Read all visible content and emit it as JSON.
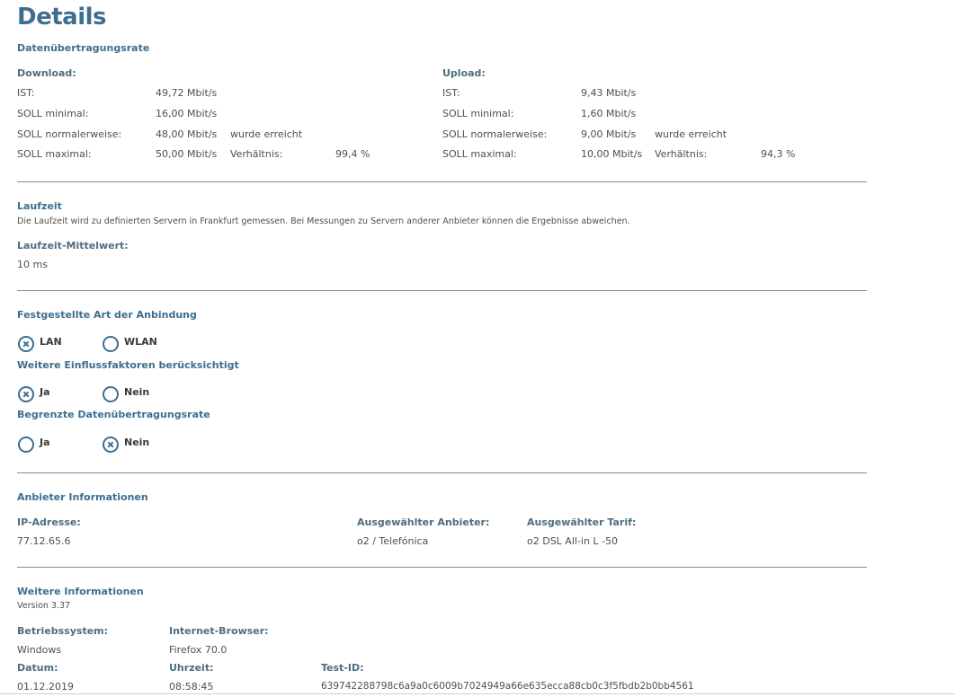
{
  "page": {
    "title": "Details"
  },
  "rate": {
    "section_title": "Datenübertragungsrate",
    "download": {
      "heading": "Download:",
      "ist_label": "IST:",
      "ist_value": "49,72 Mbit/s",
      "min_label": "SOLL minimal:",
      "min_value": "16,00 Mbit/s",
      "normal_label": "SOLL normalerweise:",
      "normal_value": "48,00 Mbit/s",
      "normal_status": "wurde erreicht",
      "max_label": "SOLL maximal:",
      "max_value": "50,00 Mbit/s",
      "ratio_label": "Verhältnis:",
      "ratio_value": "99,4 %"
    },
    "upload": {
      "heading": "Upload:",
      "ist_label": "IST:",
      "ist_value": "9,43 Mbit/s",
      "min_label": "SOLL minimal:",
      "min_value": "1,60 Mbit/s",
      "normal_label": "SOLL normalerweise:",
      "normal_value": "9,00 Mbit/s",
      "normal_status": "wurde erreicht",
      "max_label": "SOLL maximal:",
      "max_value": "10,00 Mbit/s",
      "ratio_label": "Verhältnis:",
      "ratio_value": "94,3 %"
    }
  },
  "latency": {
    "section_title": "Laufzeit",
    "note": "Die Laufzeit wird zu definierten Servern in Frankfurt gemessen. Bei Messungen zu Servern anderer Anbieter können die Ergebnisse abweichen.",
    "mean_label": "Laufzeit-Mittelwert:",
    "mean_value": "10 ms"
  },
  "connection": {
    "section_title": "Festgestellte Art der Anbindung",
    "type_options": [
      {
        "label": "LAN",
        "checked": true
      },
      {
        "label": "WLAN",
        "checked": false
      }
    ],
    "factors_title": "Weitere Einflussfaktoren berücksichtigt",
    "factors_options": [
      {
        "label": "Ja",
        "checked": true
      },
      {
        "label": "Nein",
        "checked": false
      }
    ],
    "limited_title": "Begrenzte Datenübertragungsrate",
    "limited_options": [
      {
        "label": "Ja",
        "checked": false
      },
      {
        "label": "Nein",
        "checked": true
      }
    ]
  },
  "provider": {
    "section_title": "Anbieter Informationen",
    "ip_label": "IP-Adresse:",
    "ip_value": "77.12.65.6",
    "provider_label": "Ausgewählter Anbieter:",
    "provider_value": "o2 / Telefónica",
    "tariff_label": "Ausgewählter Tarif:",
    "tariff_value": "o2 DSL All-in L -50"
  },
  "info": {
    "section_title": "Weitere Informationen",
    "version": "Version 3.37",
    "os_label": "Betriebssystem:",
    "os_value": "Windows",
    "browser_label": "Internet-Browser:",
    "browser_value": "Firefox 70.0",
    "date_label": "Datum:",
    "date_value": "01.12.2019",
    "time_label": "Uhrzeit:",
    "time_value": "08:58:45",
    "testid_label": "Test-ID:",
    "testid_value": "639742288798c6a9a0c6009b7024949a66e635ecca88cb0c3f5fbdb2b0bb4561"
  }
}
